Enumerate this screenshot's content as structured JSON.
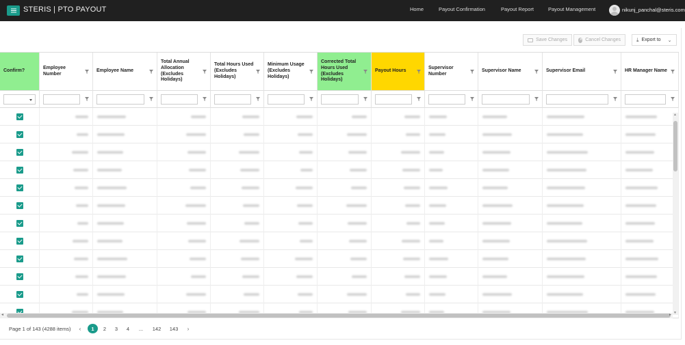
{
  "app": {
    "title": "STERIS | PTO PAYOUT",
    "menu_icon": "hamburger-icon"
  },
  "nav": {
    "items": [
      "Home",
      "Payout Confirmation",
      "Payout Report",
      "Payout Management"
    ],
    "user": "nikunj_panchal@steris.com"
  },
  "toolbar": {
    "save_label": "Save Changes",
    "cancel_label": "Cancel Changes",
    "export_label": "Export to"
  },
  "columns": [
    {
      "label": "Confirm?",
      "highlight": "green"
    },
    {
      "label": "Employee Number"
    },
    {
      "label": "Employee Name"
    },
    {
      "label": "Total Annual Allocation (Excludes Holidays)"
    },
    {
      "label": "Total Hours Used (Excludes Holidays)"
    },
    {
      "label": "Minimum Usage (Excludes Holidays)"
    },
    {
      "label": "Corrected Total Hours Used (Excludes Holidays)",
      "highlight": "green"
    },
    {
      "label": "Payout Hours",
      "highlight": "yellow"
    },
    {
      "label": "Supervisor Number"
    },
    {
      "label": "Supervisor Name"
    },
    {
      "label": "Supervisor Email"
    },
    {
      "label": "HR Manager Name"
    }
  ],
  "rows": {
    "visible_count": 12,
    "confirmed": true
  },
  "pager": {
    "info": "Page 1 of 143 (4288 items)",
    "current": "1",
    "pages": [
      "1",
      "2",
      "3",
      "4",
      "...",
      "142",
      "143"
    ]
  },
  "colors": {
    "accent": "#1a9b8b",
    "green_header": "#90ee90",
    "yellow_header": "#ffd700",
    "topbar": "#202020"
  }
}
